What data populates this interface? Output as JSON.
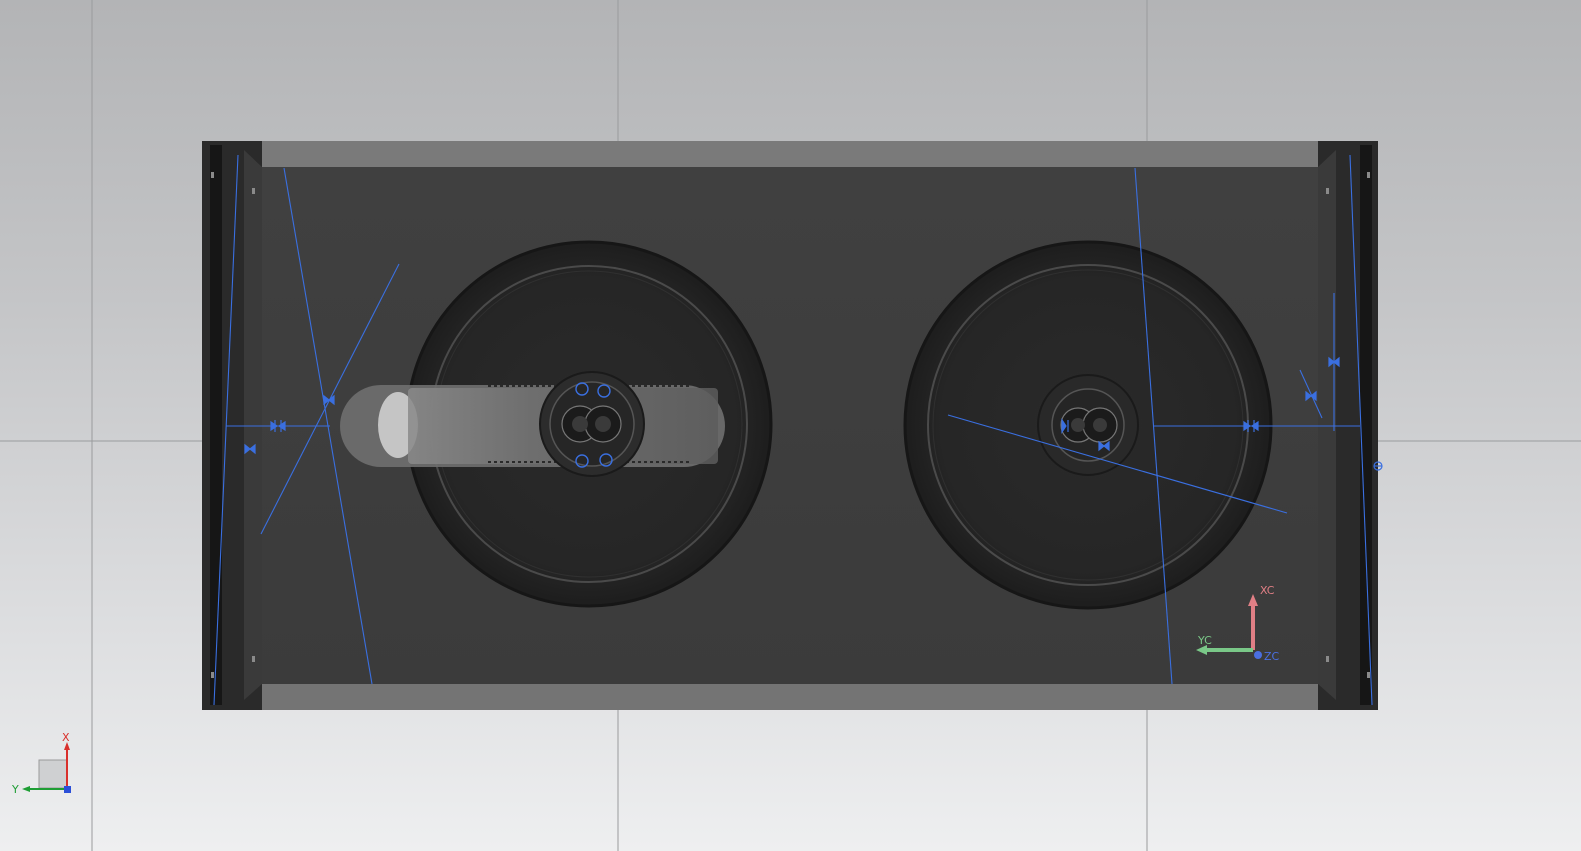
{
  "viewport": {
    "background_top": "#b3b4b6",
    "background_bottom": "#eeeff0",
    "model_color": "#3e3e3e",
    "constraint_color": "#3a6fe0"
  },
  "wcs_triad": {
    "x_label": "X",
    "y_label": "Y",
    "x_color": "#d9302c",
    "y_color": "#1f9e35",
    "z_color": "#2b4fd8"
  },
  "csys_triad": {
    "x_label": "XC",
    "y_label": "YC",
    "z_label": "ZC",
    "x_color": "#d9302c",
    "y_color": "#1f9e35",
    "z_color": "#2b4fd8"
  }
}
